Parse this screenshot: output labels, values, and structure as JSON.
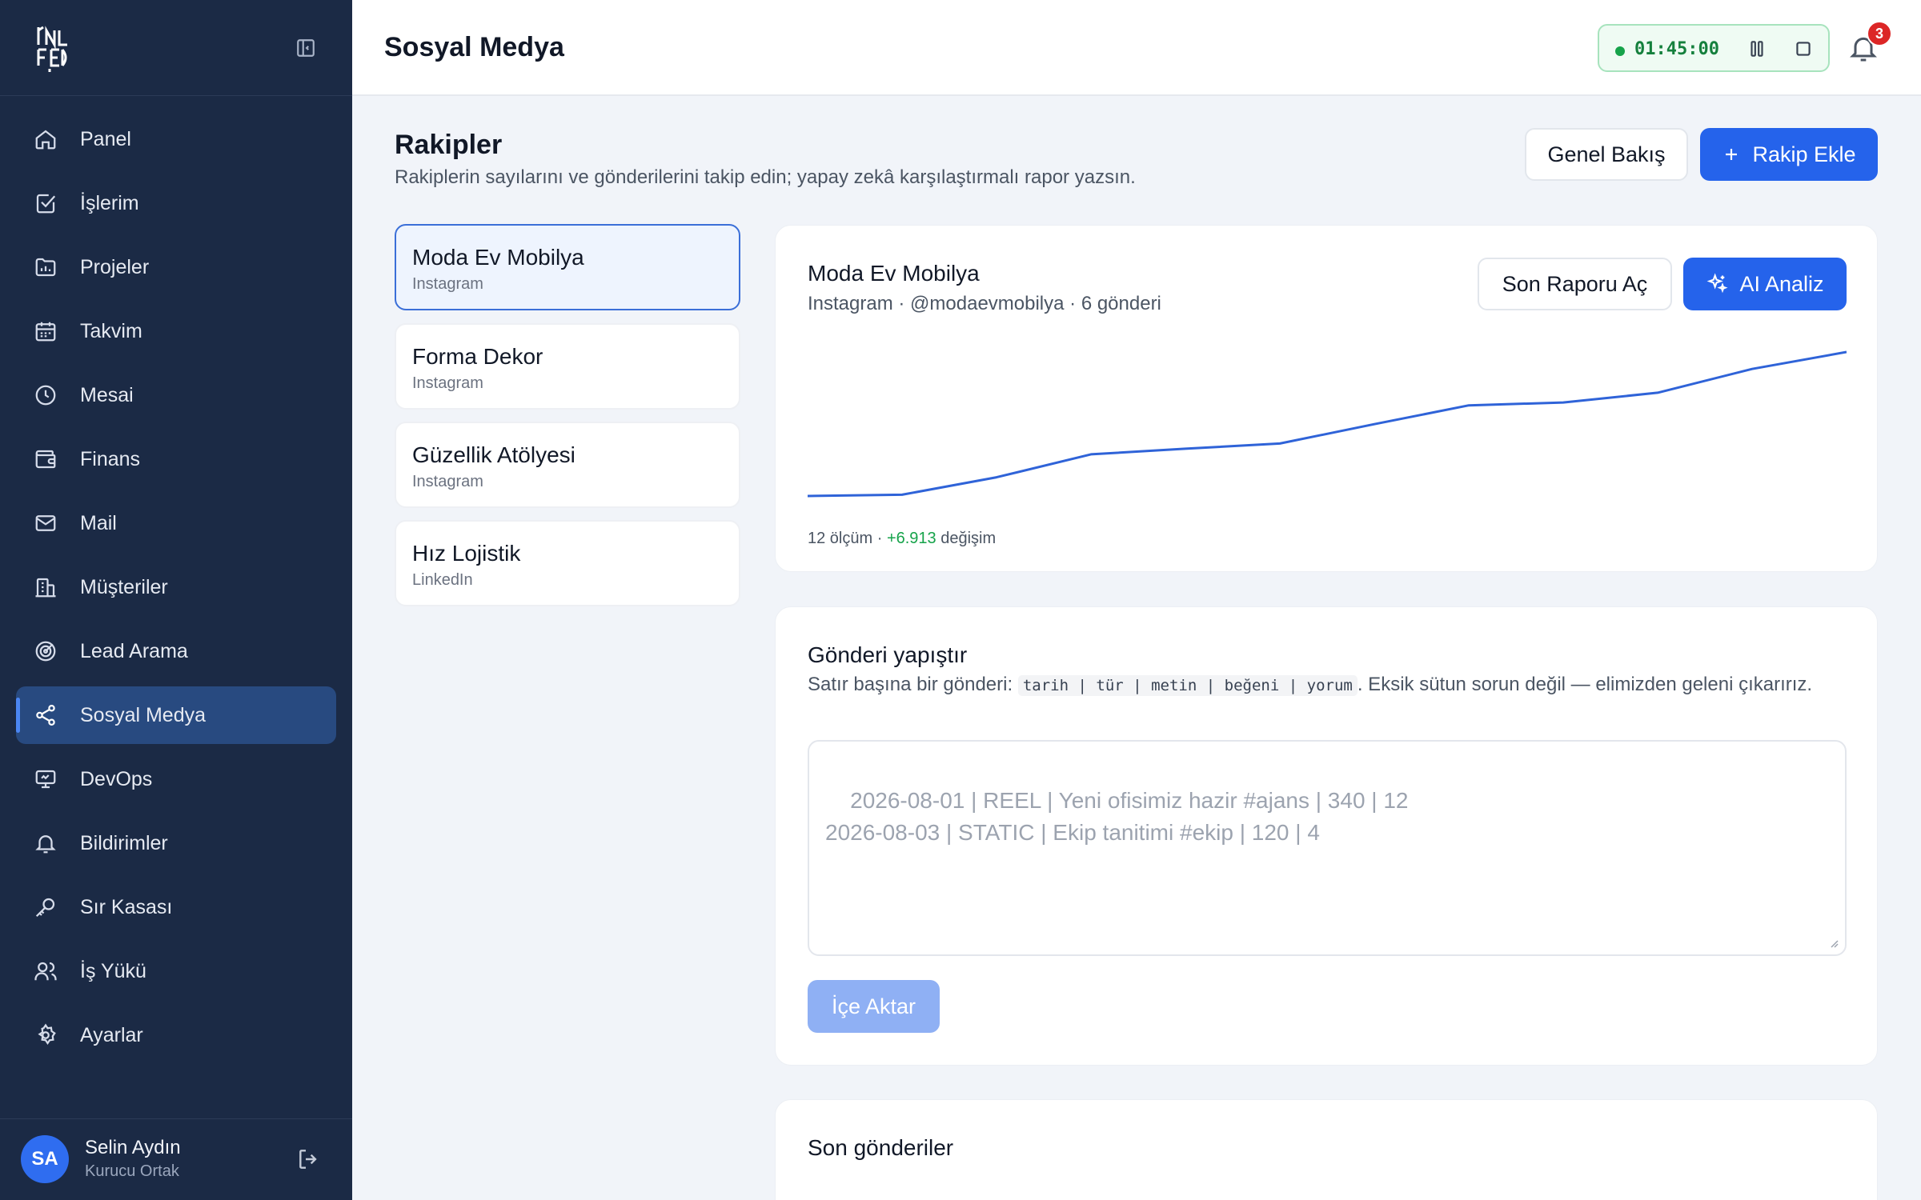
{
  "sidebar": {
    "items": [
      {
        "label": "Panel",
        "icon": "home-icon"
      },
      {
        "label": "İşlerim",
        "icon": "check-square-icon"
      },
      {
        "label": "Projeler",
        "icon": "folder-chart-icon"
      },
      {
        "label": "Takvim",
        "icon": "calendar-icon"
      },
      {
        "label": "Mesai",
        "icon": "clock-icon"
      },
      {
        "label": "Finans",
        "icon": "wallet-icon"
      },
      {
        "label": "Mail",
        "icon": "mail-icon"
      },
      {
        "label": "Müşteriler",
        "icon": "building-icon"
      },
      {
        "label": "Lead Arama",
        "icon": "target-icon"
      },
      {
        "label": "Sosyal Medya",
        "icon": "share-icon",
        "active": true
      },
      {
        "label": "DevOps",
        "icon": "monitor-icon"
      },
      {
        "label": "Bildirimler",
        "icon": "bell-icon"
      },
      {
        "label": "Sır Kasası",
        "icon": "key-icon"
      },
      {
        "label": "İş Yükü",
        "icon": "users-icon"
      },
      {
        "label": "Ayarlar",
        "icon": "gear-icon"
      }
    ],
    "user": {
      "initials": "SA",
      "name": "Selin Aydın",
      "role": "Kurucu Ortak"
    }
  },
  "topbar": {
    "title": "Sosyal Medya",
    "timer": "01:45:00",
    "notification_count": "3"
  },
  "section": {
    "title": "Rakipler",
    "subtitle": "Rakiplerin sayılarını ve gönderilerini takip edin; yapay zekâ karşılaştırmalı rapor yazsın.",
    "overview_label": "Genel Bakış",
    "add_label": "Rakip Ekle"
  },
  "competitors": [
    {
      "name": "Moda Ev Mobilya",
      "platform": "Instagram"
    },
    {
      "name": "Forma Dekor",
      "platform": "Instagram"
    },
    {
      "name": "Güzellik Atölyesi",
      "platform": "Instagram"
    },
    {
      "name": "Hız Lojistik",
      "platform": "LinkedIn"
    }
  ],
  "detail": {
    "name": "Moda Ev Mobilya",
    "meta": "Instagram · @modaevmobilya · 6 gönderi",
    "report_label": "Son Raporu Aç",
    "ai_label": "AI Analiz",
    "foot_count": "12 ölçüm · ",
    "foot_change": "+6.913",
    "foot_suffix": " değişim"
  },
  "chart_data": {
    "type": "line",
    "x": [
      1,
      2,
      3,
      4,
      5,
      6,
      7,
      8,
      9,
      10,
      11,
      12
    ],
    "series": [
      {
        "values": [
          0,
          60,
          900,
          2000,
          2270,
          2520,
          3450,
          4350,
          4490,
          4960,
          6100,
          6913
        ]
      }
    ],
    "color": "#2f63d8"
  },
  "paste": {
    "title": "Gönderi yapıştır",
    "desc_pre": "Satır başına bir gönderi: ",
    "chips": [
      "tarih",
      "|",
      "tür",
      "|",
      "metin",
      "|",
      "beğeni",
      "|",
      "yorum"
    ],
    "desc_post": ". Eksik sütun sorun değil — elimizden geleni çıkarırız.",
    "placeholder": "2026-08-01 | REEL | Yeni ofisimiz hazir #ajans | 340 | 12\n2026-08-03 | STATIC | Ekip tanitimi #ekip | 120 | 4",
    "import_label": "İçe Aktar"
  },
  "recent": {
    "title": "Son gönderiler"
  }
}
